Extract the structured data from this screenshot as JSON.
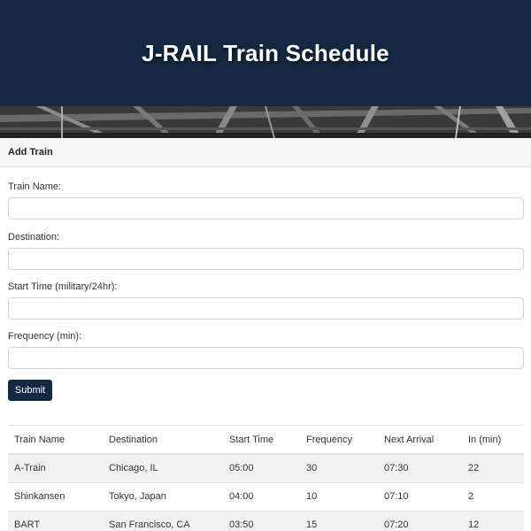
{
  "header": {
    "title": "J-RAIL Train Schedule"
  },
  "form": {
    "title": "Add Train",
    "fields": [
      {
        "label": "Train Name:",
        "value": "",
        "placeholder": ""
      },
      {
        "label": "Destination:",
        "value": "",
        "placeholder": ""
      },
      {
        "label": "Start Time (military/24hr):",
        "value": "",
        "placeholder": ""
      },
      {
        "label": "Frequency (min):",
        "value": "",
        "placeholder": ""
      }
    ],
    "submit_label": "Submit"
  },
  "table": {
    "columns": [
      "Train Name",
      "Destination",
      "Start Time",
      "Frequency",
      "Next Arrival",
      "In (min)"
    ],
    "rows": [
      [
        "A-Train",
        "Chicago, IL",
        "05:00",
        "30",
        "07:30",
        "22"
      ],
      [
        "Shinkansen",
        "Tokyo, Japan",
        "04:00",
        "10",
        "07:10",
        "2"
      ],
      [
        "BART",
        "San Francisco, CA",
        "03:50",
        "15",
        "07:20",
        "12"
      ]
    ]
  },
  "colors": {
    "header_bg": "#142842",
    "button_bg": "#142842",
    "stripe": "#f2f2f2"
  }
}
